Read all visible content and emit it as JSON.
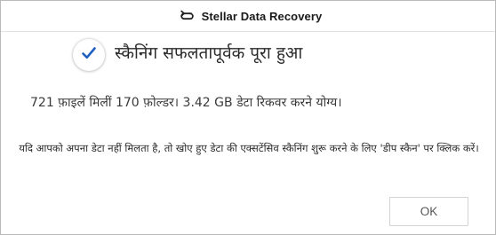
{
  "window": {
    "title": "Stellar Data Recovery",
    "app_icon": "stellar-logo-icon"
  },
  "result": {
    "status_icon": "checkmark-icon",
    "headline": "स्कैनिंग सफलतापूर्वक पूरा हुआ",
    "summary": "721 फ़ाइलें मिलीं 170 फ़ोल्डर। 3.42 GB डेटा रिकवर करने योग्य।",
    "hint": "यदि आपको अपना डेटा नहीं मिलता है, तो खोए हुए डेटा की एक्सटेंसिव स्कैनिंग शुरू करने के लिए 'डीप स्कैन' पर क्लिक करें।"
  },
  "actions": {
    "ok_label": "OK"
  },
  "colors": {
    "accent": "#1f5fbf",
    "border": "#b9b9b9"
  }
}
